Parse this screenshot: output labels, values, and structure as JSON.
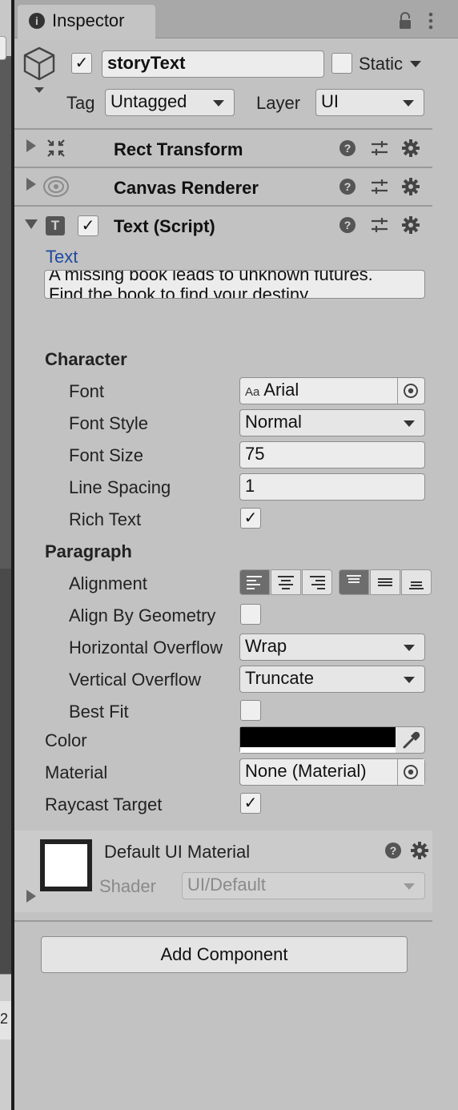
{
  "tab": {
    "title": "Inspector",
    "info_icon": "i"
  },
  "header": {
    "name": "storyText",
    "static_label": "Static",
    "tag_label": "Tag",
    "tag_value": "Untagged",
    "layer_label": "Layer",
    "layer_value": "UI"
  },
  "components": {
    "rect_transform": "Rect Transform",
    "canvas_renderer": "Canvas Renderer",
    "text_script": "Text (Script)",
    "text_type_icon": "T",
    "help_glyph": "?"
  },
  "text_section": {
    "label": "Text",
    "content_line1": "A missing book leads to unknown futures.",
    "content_line2": "Find the book to find your destiny"
  },
  "character": {
    "header": "Character",
    "font_label": "Font",
    "font_prefix": "Aa",
    "font_value": "Arial",
    "font_style_label": "Font Style",
    "font_style_value": "Normal",
    "font_size_label": "Font Size",
    "font_size_value": "75",
    "line_spacing_label": "Line Spacing",
    "line_spacing_value": "1",
    "rich_text_label": "Rich Text",
    "rich_text_checked": true
  },
  "paragraph": {
    "header": "Paragraph",
    "alignment_label": "Alignment",
    "alignment_selected_horizontal": "left",
    "alignment_selected_vertical": "top",
    "align_geometry_label": "Align By Geometry",
    "align_geometry_checked": false,
    "h_overflow_label": "Horizontal Overflow",
    "h_overflow_value": "Wrap",
    "v_overflow_label": "Vertical Overflow",
    "v_overflow_value": "Truncate",
    "best_fit_label": "Best Fit",
    "best_fit_checked": false
  },
  "misc": {
    "color_label": "Color",
    "color_value": "#000000",
    "material_label": "Material",
    "material_value": "None (Material)",
    "raycast_label": "Raycast Target",
    "raycast_checked": true
  },
  "material": {
    "name": "Default UI Material",
    "shader_label": "Shader",
    "shader_value": "UI/Default"
  },
  "add_component": "Add Component",
  "left_panel_fragment": "2",
  "colors": {
    "panel_bg": "#c2c2c2",
    "tab_bar": "#a8a8a8",
    "link_blue": "#1f4aa0",
    "selected_align": "#6d6d6d"
  }
}
